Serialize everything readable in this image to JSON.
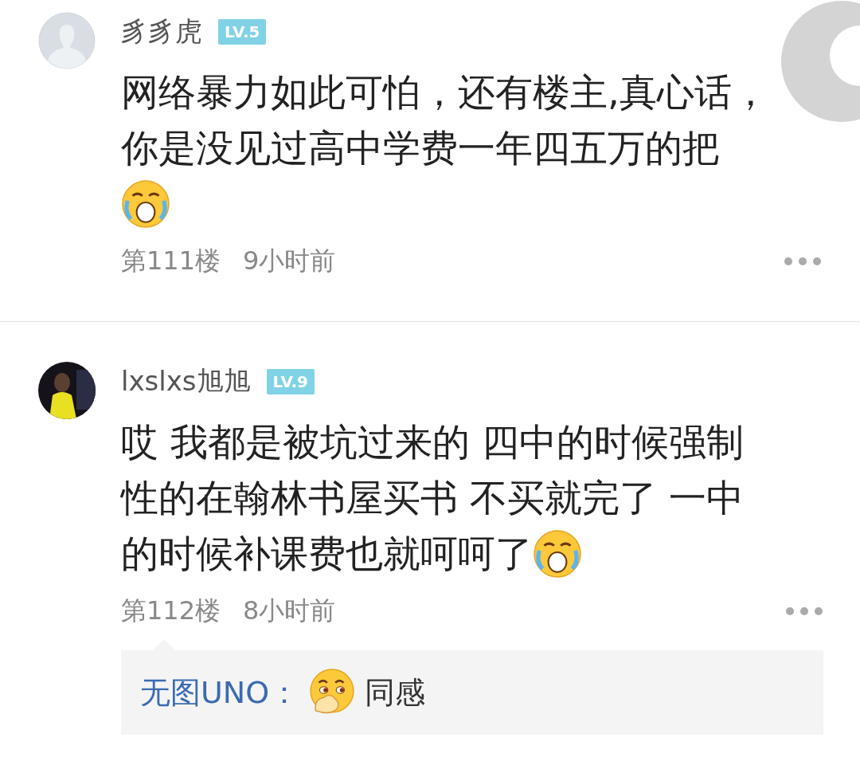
{
  "comments": [
    {
      "user": "豸豸虎",
      "kind": "guest",
      "level": "LV.5",
      "body": [
        [
          {
            "kind": "text",
            "text": "网络暴力如此可怕，还有楼主,真心话，"
          }
        ],
        [
          {
            "kind": "text",
            "text": "你是没见过高中学费一年四五万的把"
          }
        ],
        [
          {
            "kind": "cry"
          }
        ]
      ],
      "floor": "第111楼",
      "time": "9小时前"
    },
    {
      "user": "lxslxs旭旭",
      "level": "LV.9",
      "body": [
        [
          {
            "kind": "text",
            "text": "哎 我都是被坑过来的 四中的时候强制"
          }
        ],
        [
          {
            "kind": "text",
            "text": "性的在翰林书屋买书 不买就完了 一中"
          }
        ],
        [
          {
            "kind": "text",
            "text": "的时候补课费也就呵呵了"
          },
          {
            "kind": "cry"
          }
        ]
      ],
      "floor": "第112楼",
      "time": "8小时前",
      "replies": [
        {
          "user": "无图UNO：",
          "body": [
            {
              "kind": "shy"
            },
            {
              "kind": "text",
              "text": "同感"
            }
          ]
        }
      ]
    }
  ]
}
